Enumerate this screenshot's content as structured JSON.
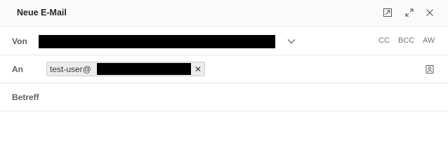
{
  "window": {
    "title": "Neue E-Mail"
  },
  "titlebar_buttons": [
    {
      "name": "popout-icon"
    },
    {
      "name": "expand-icon"
    },
    {
      "name": "close-icon"
    }
  ],
  "from_row": {
    "label": "Von",
    "cc_label": "CC",
    "bcc_label": "BCC",
    "aw_label": "AW"
  },
  "to_row": {
    "label": "An",
    "recipient_prefix": "test-user@",
    "remove_symbol": "✕"
  },
  "subject_row": {
    "label": "Betreff",
    "value": ""
  },
  "colors": {
    "titlebar_bg": "#fafafa",
    "chip_bg": "#ececec",
    "divider": "#e6e6e6",
    "redaction": "#000000"
  }
}
